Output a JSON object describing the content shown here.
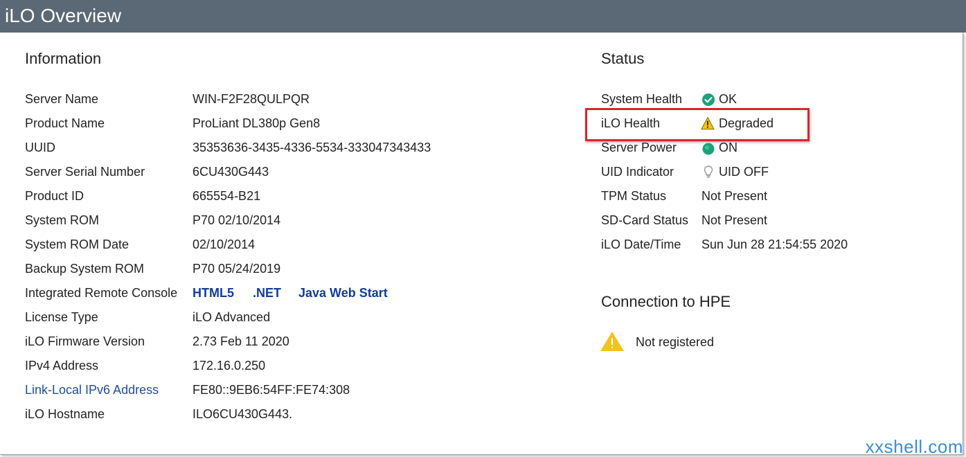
{
  "header": {
    "title": "iLO Overview"
  },
  "information": {
    "title": "Information",
    "rows": [
      {
        "label": "Server Name",
        "value": "WIN-F2F28QULPQR"
      },
      {
        "label": "Product Name",
        "value": "ProLiant DL380p Gen8"
      },
      {
        "label": "UUID",
        "value": "35353636-3435-4336-5534-333047343433"
      },
      {
        "label": "Server Serial Number",
        "value": "6CU430G443"
      },
      {
        "label": "Product ID",
        "value": "665554-B21"
      },
      {
        "label": "System ROM",
        "value": "P70 02/10/2014"
      },
      {
        "label": "System ROM Date",
        "value": "02/10/2014"
      },
      {
        "label": "Backup System ROM",
        "value": "P70 05/24/2019"
      },
      {
        "label": "Integrated Remote Console",
        "links": [
          "HTML5",
          ".NET",
          "Java Web Start"
        ]
      },
      {
        "label": "License Type",
        "value": "iLO Advanced"
      },
      {
        "label": "iLO Firmware Version",
        "value": "2.73 Feb 11 2020"
      },
      {
        "label": "IPv4 Address",
        "value": "172.16.0.250"
      },
      {
        "label": "Link-Local IPv6 Address",
        "value": "FE80::9EB6:54FF:FE74:308"
      },
      {
        "label": "iLO Hostname",
        "value": "ILO6CU430G443."
      }
    ]
  },
  "status": {
    "title": "Status",
    "rows": [
      {
        "label": "System Health",
        "value": "OK",
        "icon": "check-circle-icon",
        "color": "#1aa37a"
      },
      {
        "label": "iLO Health",
        "value": "Degraded",
        "icon": "warning-icon",
        "color": "#f2c31b"
      },
      {
        "label": "Server Power",
        "value": "ON",
        "icon": "power-on-dot-icon",
        "color": "#1aa37a"
      },
      {
        "label": "UID Indicator",
        "value": "UID OFF",
        "icon": "lightbulb-icon",
        "color": "#9a9a9a"
      },
      {
        "label": "TPM Status",
        "value": "Not Present"
      },
      {
        "label": "SD-Card Status",
        "value": "Not Present"
      },
      {
        "label": "iLO Date/Time",
        "value": "Sun Jun 28 21:54:55 2020"
      }
    ]
  },
  "connection": {
    "title": "Connection to HPE",
    "status_text": "Not registered",
    "icon": "warning-icon"
  },
  "watermark": "xxshell.com",
  "colors": {
    "header_bg": "#5b6875",
    "link": "#113d99",
    "highlight": "#d9242a",
    "ok_green": "#1aa37a",
    "warning_yellow": "#f2c31b"
  }
}
